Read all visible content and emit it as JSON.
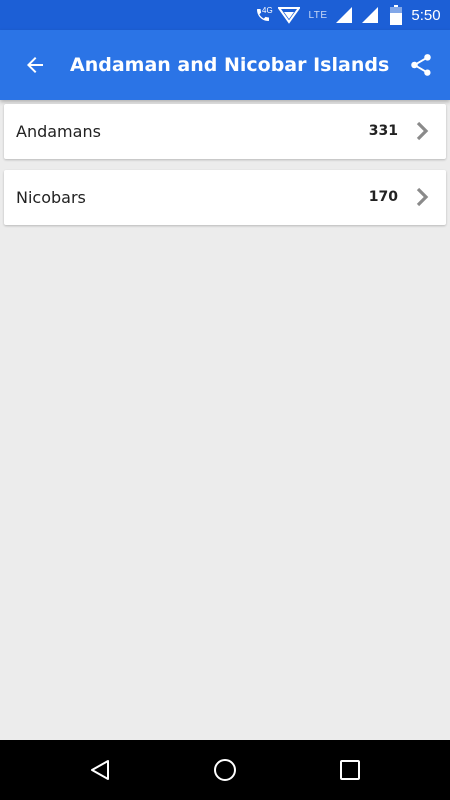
{
  "status_bar": {
    "network_label": "4G",
    "lte_label": "LTE",
    "time": "5:50"
  },
  "app_bar": {
    "title": "Andaman and Nicobar Islands",
    "back_icon": "arrow-back-icon",
    "share_icon": "share-icon"
  },
  "items": [
    {
      "label": "Andamans",
      "count": "331"
    },
    {
      "label": "Nicobars",
      "count": "170"
    }
  ],
  "nav_bar": {
    "back_icon": "nav-back-icon",
    "home_icon": "nav-home-icon",
    "recents_icon": "nav-recents-icon"
  },
  "colors": {
    "status_bar": "#1c5fd6",
    "app_bar": "#2b74e6",
    "background": "#ececec",
    "card": "#ffffff",
    "chevron": "#8a8a8a"
  }
}
